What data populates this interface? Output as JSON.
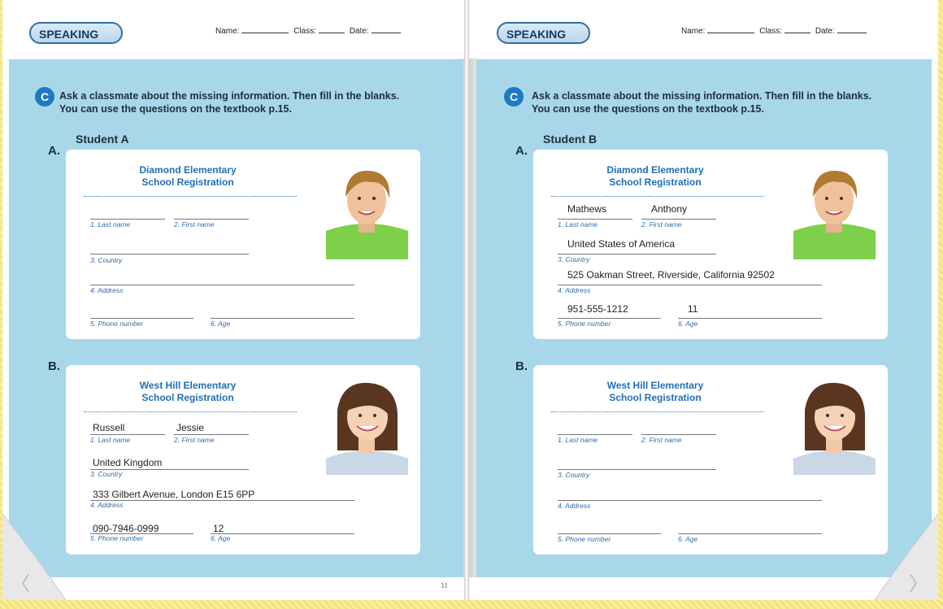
{
  "header": {
    "speaking": "SPEAKING",
    "name_label": "Name:",
    "class_label": "Class:",
    "date_label": "Date:"
  },
  "badge": "C",
  "instruction_line1": "Ask a classmate about the missing information. Then fill in the blanks.",
  "instruction_line2": "You can use the questions on the textbook p.15.",
  "labels": {
    "last": "1. Last name",
    "first": "2. First name",
    "country": "3. Country",
    "address": "4. Address",
    "phone": "5. Phone number",
    "age": "6. Age"
  },
  "left": {
    "student": "Student A",
    "page_number": "11",
    "a": {
      "letter": "A.",
      "school1": "Diamond Elementary",
      "school2": "School Registration",
      "last": "",
      "first": "",
      "country": "",
      "address": "",
      "phone": "",
      "age": ""
    },
    "b": {
      "letter": "B.",
      "school1": "West Hill Elementary",
      "school2": "School Registration",
      "last": "Russell",
      "first": "Jessie",
      "country": "United Kingdom",
      "address": "333 Gilbert Avenue, London E15 6PP",
      "phone": "090-7946-0999",
      "age": "12"
    }
  },
  "right": {
    "student": "Student B",
    "a": {
      "letter": "A.",
      "school1": "Diamond Elementary",
      "school2": "School Registration",
      "last": "Mathews",
      "first": "Anthony",
      "country": "United States of America",
      "address": "525 Oakman Street, Riverside, California 92502",
      "phone": "951-555-1212",
      "age": "11"
    },
    "b": {
      "letter": "B.",
      "school1": "West Hill Elementary",
      "school2": "School Registration",
      "last": "",
      "first": "",
      "country": "",
      "address": "",
      "phone": "",
      "age": ""
    }
  },
  "icons": {
    "prev": "chevron-left-icon",
    "next": "chevron-right-icon"
  }
}
